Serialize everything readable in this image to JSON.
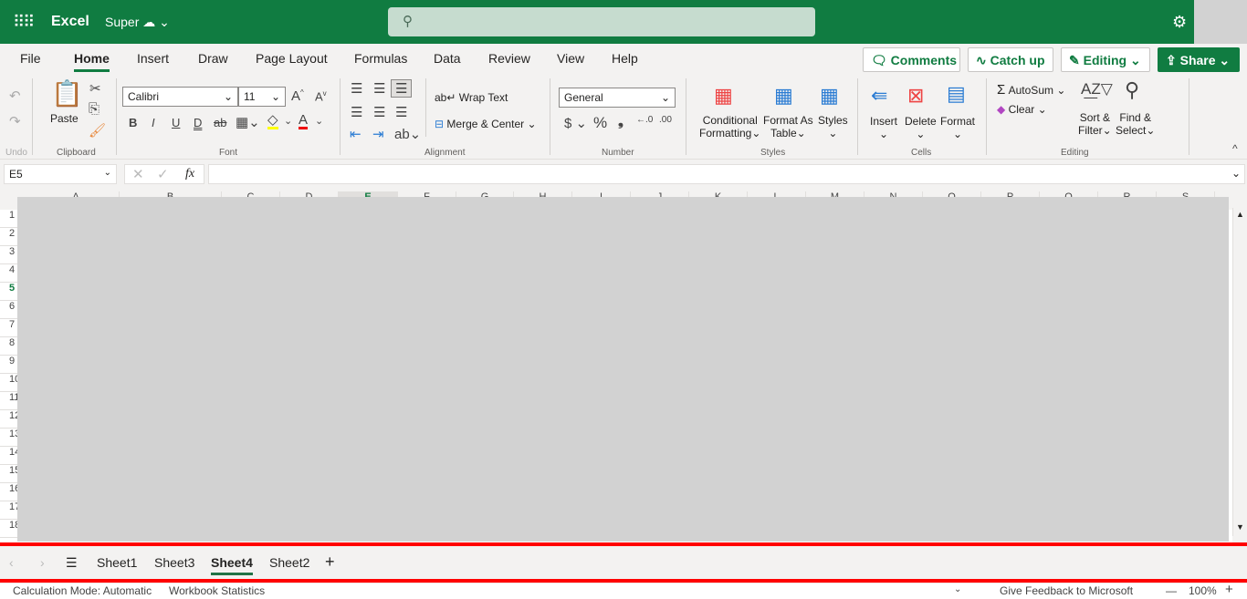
{
  "header": {
    "app": "Excel",
    "doc": "Super",
    "search_placeholder": ""
  },
  "menu": {
    "tabs": [
      "File",
      "Home",
      "Insert",
      "Draw",
      "Page Layout",
      "Formulas",
      "Data",
      "Review",
      "View",
      "Help"
    ],
    "active": "Home"
  },
  "actions": {
    "comments": "Comments",
    "catchup": "Catch up",
    "editing": "Editing",
    "share": "Share"
  },
  "ribbon": {
    "undo_group": "Undo",
    "clipboard_group": "Clipboard",
    "paste": "Paste",
    "font_group": "Font",
    "font": "Calibri",
    "size": "11",
    "alignment_group": "Alignment",
    "wrap": "Wrap Text",
    "merge": "Merge & Center",
    "number_group": "Number",
    "format": "General",
    "styles_group": "Styles",
    "cond1": "Conditional",
    "cond2": "Formatting",
    "fat1": "Format As",
    "fat2": "Table",
    "styles": "Styles",
    "cells_group": "Cells",
    "insert": "Insert",
    "delete": "Delete",
    "format_btn": "Format",
    "editing_group": "Editing",
    "autosum": "AutoSum",
    "clear": "Clear",
    "sort1": "Sort &",
    "sort2": "Filter",
    "find1": "Find &",
    "find2": "Select"
  },
  "formula_bar": {
    "name_box": "E5",
    "formula": ""
  },
  "grid": {
    "columns": [
      "A",
      "B",
      "C",
      "D",
      "E",
      "F",
      "G",
      "H",
      "I",
      "J",
      "K",
      "L",
      "M",
      "N",
      "O",
      "P",
      "Q",
      "R",
      "S"
    ],
    "rows": [
      "1",
      "2",
      "3",
      "4",
      "5",
      "6",
      "7",
      "8",
      "9",
      "10",
      "11",
      "12",
      "13",
      "14",
      "15",
      "16",
      "17",
      "18"
    ],
    "selected_col": "E",
    "selected_row": "5"
  },
  "sheets": {
    "tabs": [
      "Sheet1",
      "Sheet3",
      "Sheet4",
      "Sheet2"
    ],
    "active": "Sheet4"
  },
  "status": {
    "calc": "Calculation Mode: Automatic",
    "stats": "Workbook Statistics",
    "feedback": "Give Feedback to Microsoft",
    "zoom": "100%"
  },
  "colors": {
    "brand": "#107c41",
    "overlay": "#d2d2d2",
    "highlight": "#ff0000"
  }
}
